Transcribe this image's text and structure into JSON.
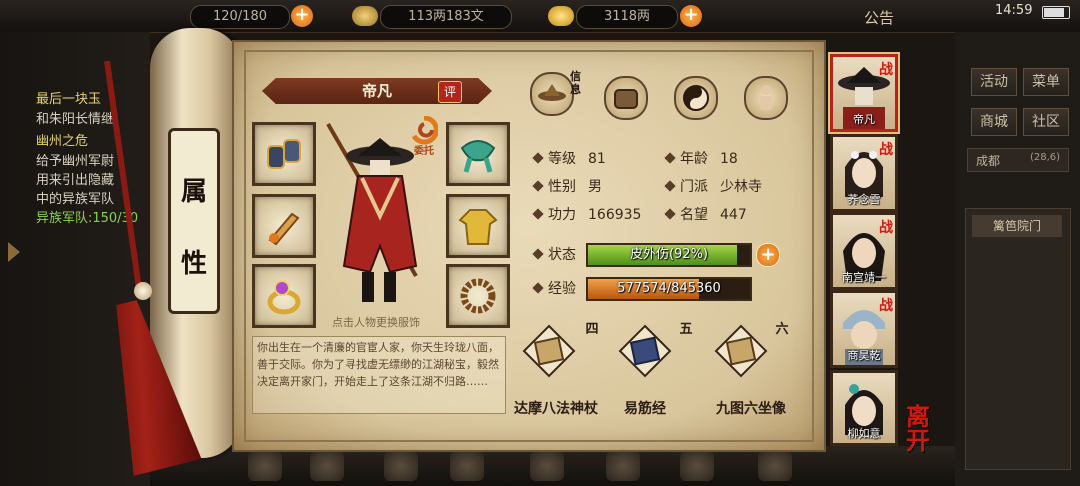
{
  "topbar": {
    "stamina": "120/180",
    "silver": "113两183文",
    "gold": "3118两",
    "announcement": "公告",
    "time": "14:59"
  },
  "quests": {
    "q1_title": "最后一块玉",
    "q1_desc": "和朱阳长情继",
    "q2_title": "幽州之危",
    "q2_line1": "给予幽州军尉",
    "q2_line2": "用来引出隐藏",
    "q2_line3": "中的异族军队",
    "q2_progress": "异族军队:150/30"
  },
  "right_menu": {
    "activity": "活动",
    "menu": "菜单",
    "city": "商城",
    "community": "社区",
    "location": "成都",
    "coords": "(28,6)",
    "place": "篱笆院门"
  },
  "scroll": {
    "char1": "属",
    "char2": "性"
  },
  "character": {
    "name": "帝凡",
    "rate_badge": "评",
    "delegate": "委托",
    "change_outfit_hint": "点击人物更换服饰",
    "bio": "你出生在一个清廉的官宦人家，你天生玲珑八面，善于交际。你为了寻找虚无缥缈的江湖秘宝，毅然决定离开家门，开始走上了这条江湖不归路……"
  },
  "tabs": {
    "info_label": "信息"
  },
  "stats": {
    "level_label": "等级",
    "level": "81",
    "age_label": "年龄",
    "age": "18",
    "gender_label": "性别",
    "gender": "男",
    "sect_label": "门派",
    "sect": "少林寺",
    "power_label": "功力",
    "power": "166935",
    "fame_label": "名望",
    "fame": "447",
    "status_label": "状态",
    "status_text": "皮外伤(92%)",
    "status_fraction": 0.92,
    "exp_label": "经验",
    "exp_text": "577574/845360",
    "exp_fraction": 0.683
  },
  "skills": [
    {
      "num": "四",
      "name": "达摩八法神杖"
    },
    {
      "num": "五",
      "name": "易筋经"
    },
    {
      "num": "六",
      "name": "九图六坐像"
    }
  ],
  "party": [
    {
      "name": "帝凡",
      "tag": "战"
    },
    {
      "name": "荞念雪",
      "tag": "战"
    },
    {
      "name": "南宫靖一",
      "tag": "战"
    },
    {
      "name": "商昊乾",
      "tag": "战"
    },
    {
      "name": "柳如意",
      "tag": ""
    }
  ],
  "leave_button": "离开"
}
